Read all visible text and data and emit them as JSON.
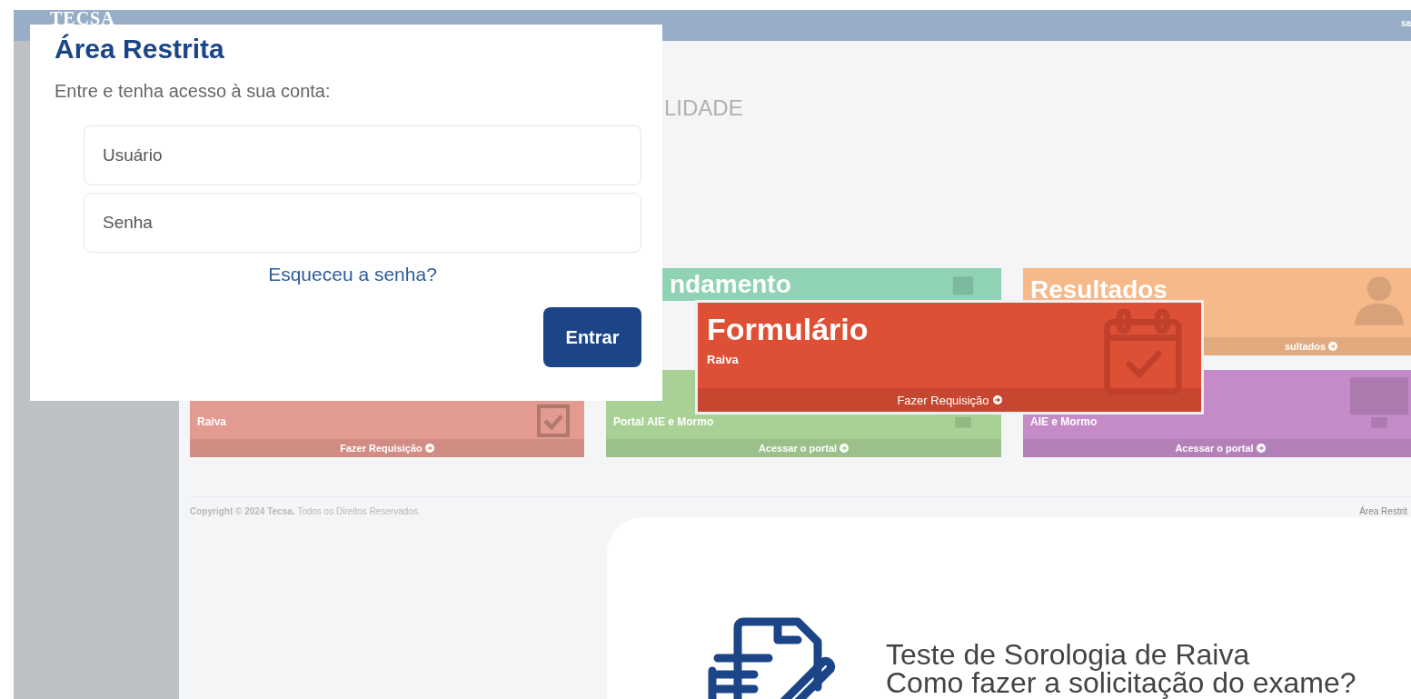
{
  "background_app": {
    "logo": "TECSA",
    "user": "sa",
    "heading": "LIDADE",
    "cards": [
      {
        "kind": "schedule",
        "title": "ndamento",
        "color": "#8fd3b4"
      },
      {
        "kind": "results",
        "title": "Resultados",
        "link": "sultados",
        "color": "#f5b98a"
      },
      {
        "kind": "form",
        "subtitle": "Raiva",
        "link": "Fazer Requisição",
        "color": "#e39a90"
      },
      {
        "kind": "access",
        "subtitle": "Portal AIE e Mormo",
        "link": "Acessar o portal",
        "color": "#a9d196"
      },
      {
        "kind": "access",
        "subtitle": "AIE e Mormo",
        "link": "Acessar o portal",
        "color": "#c48bc8"
      }
    ],
    "footer": {
      "copyright": "**Copyright © 2024 Tecsa.** Todos os Direitos Reservados.",
      "link": "Área Restrit"
    }
  },
  "login_modal": {
    "title": "Área Restrita",
    "subtitle": "Entre e tenha acesso à sua conta:",
    "username": {
      "placeholder": "Usuário"
    },
    "password": {
      "placeholder": "Senha"
    },
    "forgot_link": "Esqueceu a senha?",
    "submit": "Entrar"
  },
  "form_card": {
    "title": "Formulário",
    "subtitle": "Raiva",
    "link": "Fazer Requisição"
  },
  "info_card": {
    "lines": [
      "Teste de Sorologia de Raiva",
      "Como fazer a solicitação do exame?"
    ]
  }
}
